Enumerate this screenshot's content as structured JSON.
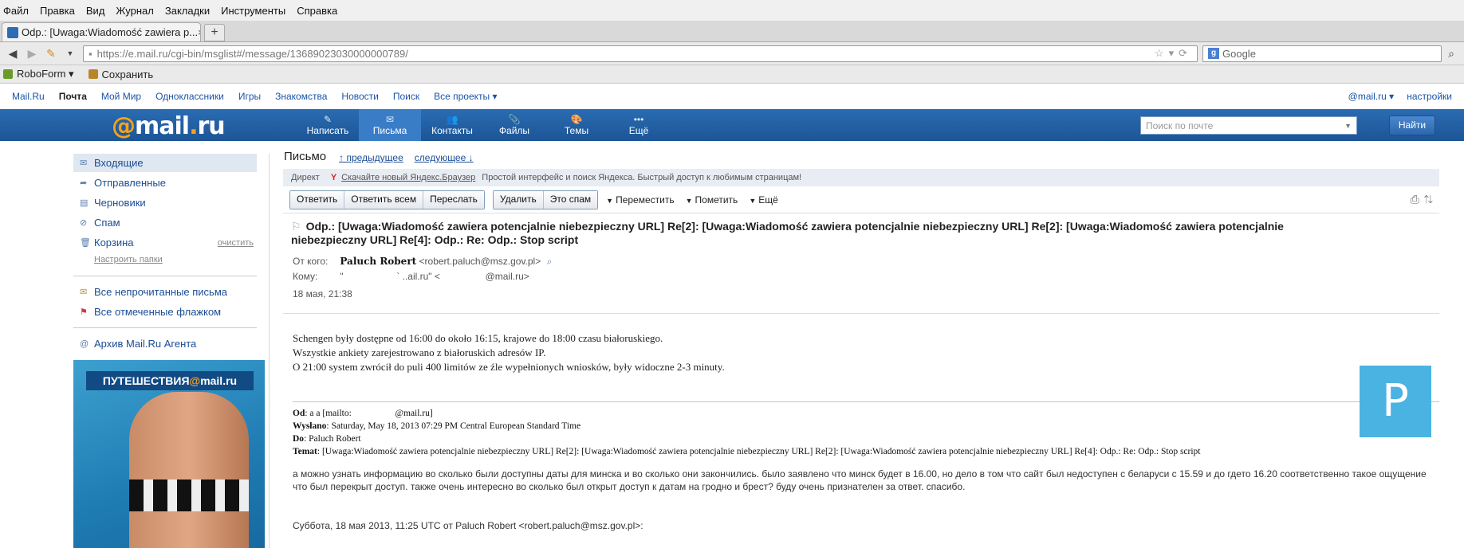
{
  "menubar": [
    "Файл",
    "Правка",
    "Вид",
    "Журнал",
    "Закладки",
    "Инструменты",
    "Справка"
  ],
  "tab": {
    "title": "Odp.: [Uwaga:Wiadomość zawiera p...",
    "close": "×",
    "new": "+"
  },
  "url": "https://e.mail.ru/cgi-bin/msglist#/message/13689023030000000789/",
  "google": "Google",
  "bookmarks": [
    "RoboForm ▾",
    "Сохранить"
  ],
  "portal": {
    "links": [
      "Mail.Ru",
      "Почта",
      "Мой Мир",
      "Одноклассники",
      "Игры",
      "Знакомства",
      "Новости",
      "Поиск",
      "Все проекты ▾"
    ],
    "account": "@mail.ru ▾",
    "settings": "настройки"
  },
  "logo": {
    "at": "@",
    "mail": "mail",
    "dot": ".",
    "ru": "ru"
  },
  "tools": [
    {
      "icon": "✎",
      "label": "Написать"
    },
    {
      "icon": "✉",
      "label": "Письма"
    },
    {
      "icon": "👥",
      "label": "Контакты"
    },
    {
      "icon": "📎",
      "label": "Файлы"
    },
    {
      "icon": "🎨",
      "label": "Темы"
    },
    {
      "icon": "•••",
      "label": "Ещё"
    }
  ],
  "search": {
    "placeholder": "Поиск по почте",
    "button": "Найти"
  },
  "sidebar": {
    "inbox": "Входящие",
    "sent": "Отправленные",
    "drafts": "Черновики",
    "spam": "Спам",
    "trash": "Корзина",
    "clear": "очистить",
    "configure": "Настроить папки",
    "unread": "Все непрочитанные письма",
    "flagged": "Все отмеченные флажком",
    "archive": "Архив Mail.Ru Агента"
  },
  "banner": {
    "part1": "ПУТЕШЕСТВИЯ",
    "at": "@",
    "part2": "mail.ru"
  },
  "message": {
    "heading": "Письмо",
    "prev": "↑ предыдущее",
    "next": "следующее ↓",
    "ad_label": "Директ",
    "ad_link": "Скачайте новый Яндекс.Браузер",
    "ad_text": "Простой интерфейс и поиск Яндекса. Быстрый доступ к любимым страницам!",
    "buttons1": [
      "Ответить",
      "Ответить всем",
      "Переслать"
    ],
    "buttons2": [
      "Удалить",
      "Это спам"
    ],
    "move": "Переместить",
    "mark": "Пометить",
    "more": "Ещё",
    "subject": "Odp.: [Uwaga:Wiadomość zawiera potencjalnie niebezpieczny URL] Re[2]: [Uwaga:Wiadomość zawiera potencjalnie niebezpieczny URL] Re[2]: [Uwaga:Wiadomość zawiera potencjalnie niebezpieczny URL] Re[4]: Odp.: Re: Odp.: Stop script",
    "from_label": "От кого:",
    "from_name": "Paluch Robert",
    "from_email": "<robert.paluch@msz.gov.pl>",
    "to_label": "Кому:",
    "to_value": "\"                    ` ..ail.ru\" <                 @mail.ru>",
    "date": "18 мая, 21:38",
    "avatar": "P",
    "body": [
      "Schengen były dostępne od 16:00 do około 16:15, krajowe do 18:00 czasu białoruskiego.",
      "Wszystkie ankiety zarejestrowano z białoruskich adresów IP.",
      "O 21:00 system zwrócił do puli 400 limitów ze źle wypełnionych wniosków, były widoczne 2-3 minuty."
    ],
    "quote": {
      "od_label": "Od",
      "od_value": ": a a [mailto:                   @mail.ru]",
      "sent_label": "Wysłano",
      "sent_value": ": Saturday, May 18, 2013 07:29 PM Central European Standard Time",
      "do_label": "Do",
      "do_value": ": Paluch Robert",
      "temat_label": "Temat",
      "temat_value": ": [Uwaga:Wiadomość zawiera potencjalnie niebezpieczny URL] Re[2]: [Uwaga:Wiadomość zawiera potencjalnie niebezpieczny URL] Re[2]: [Uwaga:Wiadomość zawiera potencjalnie niebezpieczny URL] Re[4]: Odp.: Re: Odp.: Stop script"
    },
    "russian": "а можно узнать информацию во сколько были доступны даты для минска и во сколько они закончились. было заявлено что минск будет в 16.00, но дело в том что сайт был недоступен с беларуси с 15.59 и до гдето 16.20 соответственно такое ощущение что был перекрыт доступ. также очень интересно во сколько был открыт доступ к датам на гродно и брест? буду очень признателен за ответ. спасибо.",
    "reply_line": "Суббота, 18 мая 2013, 11:25 UTC от Paluch Robert <robert.paluch@msz.gov.pl>:"
  }
}
